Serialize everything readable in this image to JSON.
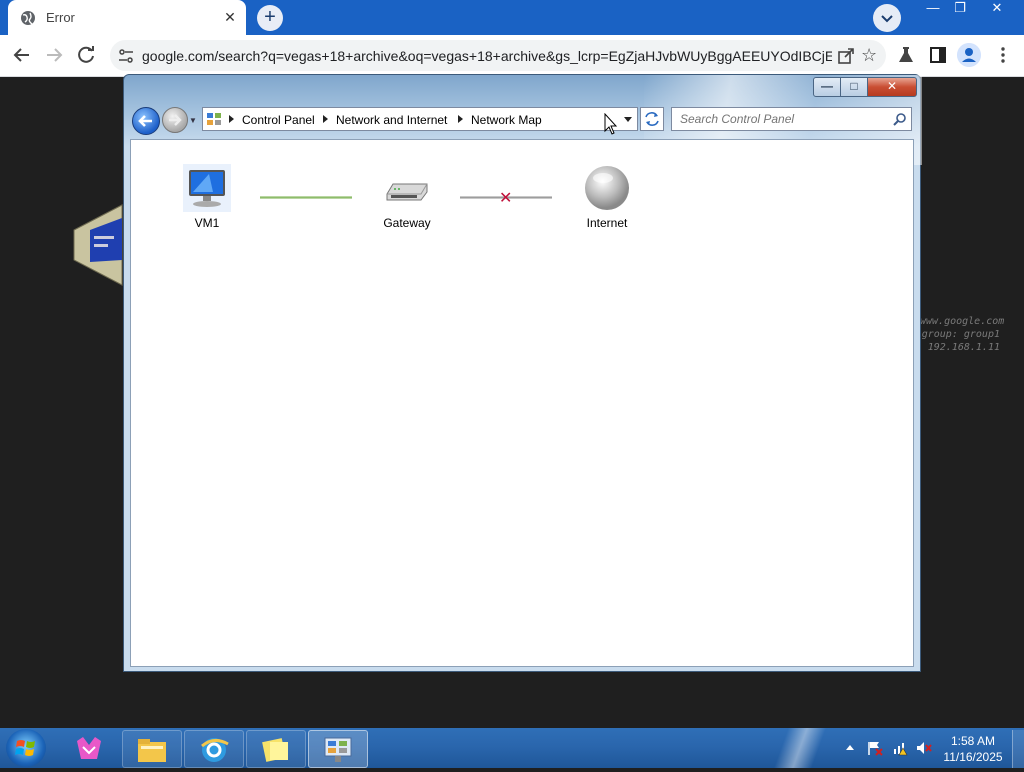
{
  "browser": {
    "tab_title": "Error",
    "tab_close": "✕",
    "new_tab": "+",
    "url": "google.com/search?q=vegas+18+archive&oq=vegas+18+archive&gs_lcrp=EgZjaHJvbWUyBggAEEUYOdIBCjE...",
    "window_controls": [
      "—",
      "❐",
      "✕"
    ]
  },
  "desktop": {
    "bg_text_lines": [
      "www.google.com",
      "group: group1",
      "192.168.1.11"
    ]
  },
  "explorer": {
    "breadcrumb": [
      "Control Panel",
      "Network and Internet",
      "Network Map"
    ],
    "search_placeholder": "Search Control Panel",
    "nodes": {
      "vm1": "VM1",
      "gateway": "Gateway",
      "internet": "Internet"
    },
    "connection_status": "✕"
  },
  "taskbar": {
    "time": "1:58 AM",
    "date": "11/16/2025"
  },
  "colors": {
    "taskbar": "#2a66ad",
    "chrome_tabstrip": "#1a62c4",
    "broken_link": "#c0103a"
  }
}
